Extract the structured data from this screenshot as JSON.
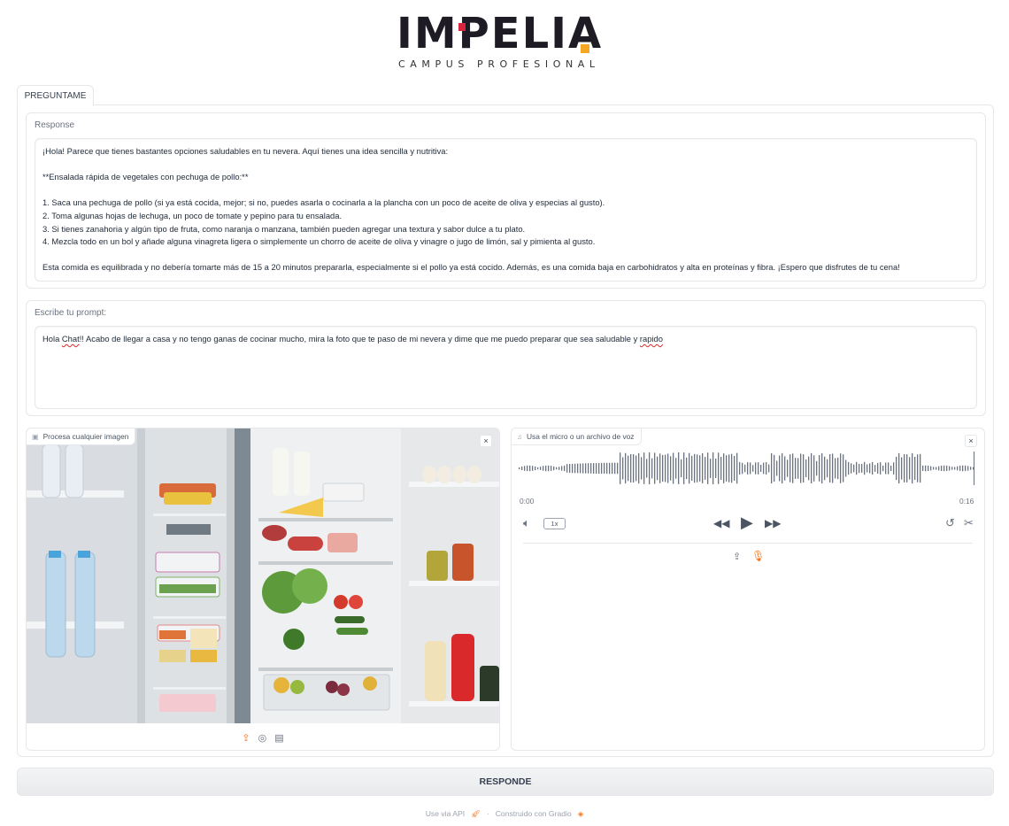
{
  "logo": {
    "name": "IMPELIA",
    "tagline": "CAMPUS PROFESIONAL"
  },
  "tab": {
    "label": "PREGUNTAME"
  },
  "response": {
    "label": "Response",
    "text": "¡Hola! Parece que tienes bastantes opciones saludables en tu nevera. Aquí tienes una idea sencilla y nutritiva:\n\n**Ensalada rápida de vegetales con pechuga de pollo:**\n\n1. Saca una pechuga de pollo (si ya está cocida, mejor; si no, puedes asarla o cocinarla a la plancha con un poco de aceite de oliva y especias al gusto).\n2. Toma algunas hojas de lechuga, un poco de tomate y pepino para tu ensalada.\n3. Si tienes zanahoria y algún tipo de fruta, como naranja o manzana, también pueden agregar una textura y sabor dulce a tu plato.\n4. Mezcla todo en un bol y añade alguna vinagreta ligera o simplemente un chorro de aceite de oliva y vinagre o jugo de limón, sal y pimienta al gusto.\n\nEsta comida es equilibrada y no debería tomarte más de 15 a 20 minutos prepararla, especialmente si el pollo ya está cocido. Además, es una comida baja en carbohidratos y alta en proteínas y fibra. ¡Espero que disfrutes de tu cena!"
  },
  "prompt": {
    "label": "Escribe tu prompt:",
    "text_before": "Hola ",
    "text_spell1": "Chat",
    "text_middle": "!! Acabo de llegar a casa y no tengo ganas de cocinar mucho, mira la foto que te paso de mi nevera y dime que me puedo preparar que sea saludable y ",
    "text_spell2": "rapido"
  },
  "image_input": {
    "label": "Procesa cualquier imagen",
    "close": "×",
    "icons": [
      "upload-icon",
      "webcam-icon",
      "clipboard-icon"
    ]
  },
  "audio_input": {
    "label": "Usa el micro o un archivo de voz",
    "close": "×",
    "time_current": "0:00",
    "time_total": "0:16",
    "speed": "1x",
    "icons": [
      "volume-icon",
      "rewind-icon",
      "play-icon",
      "fast-forward-icon",
      "undo-icon",
      "scissors-icon",
      "upload-icon",
      "microphone-icon"
    ]
  },
  "submit": {
    "label": "RESPONDE"
  },
  "footer": {
    "api": "Use via API",
    "sep": "·",
    "built": "Construido con Gradio"
  },
  "colors": {
    "accent": "#f97316",
    "brand_dark": "#1e1b24",
    "brand_red": "#d7263d",
    "brand_orange": "#f5a623"
  }
}
